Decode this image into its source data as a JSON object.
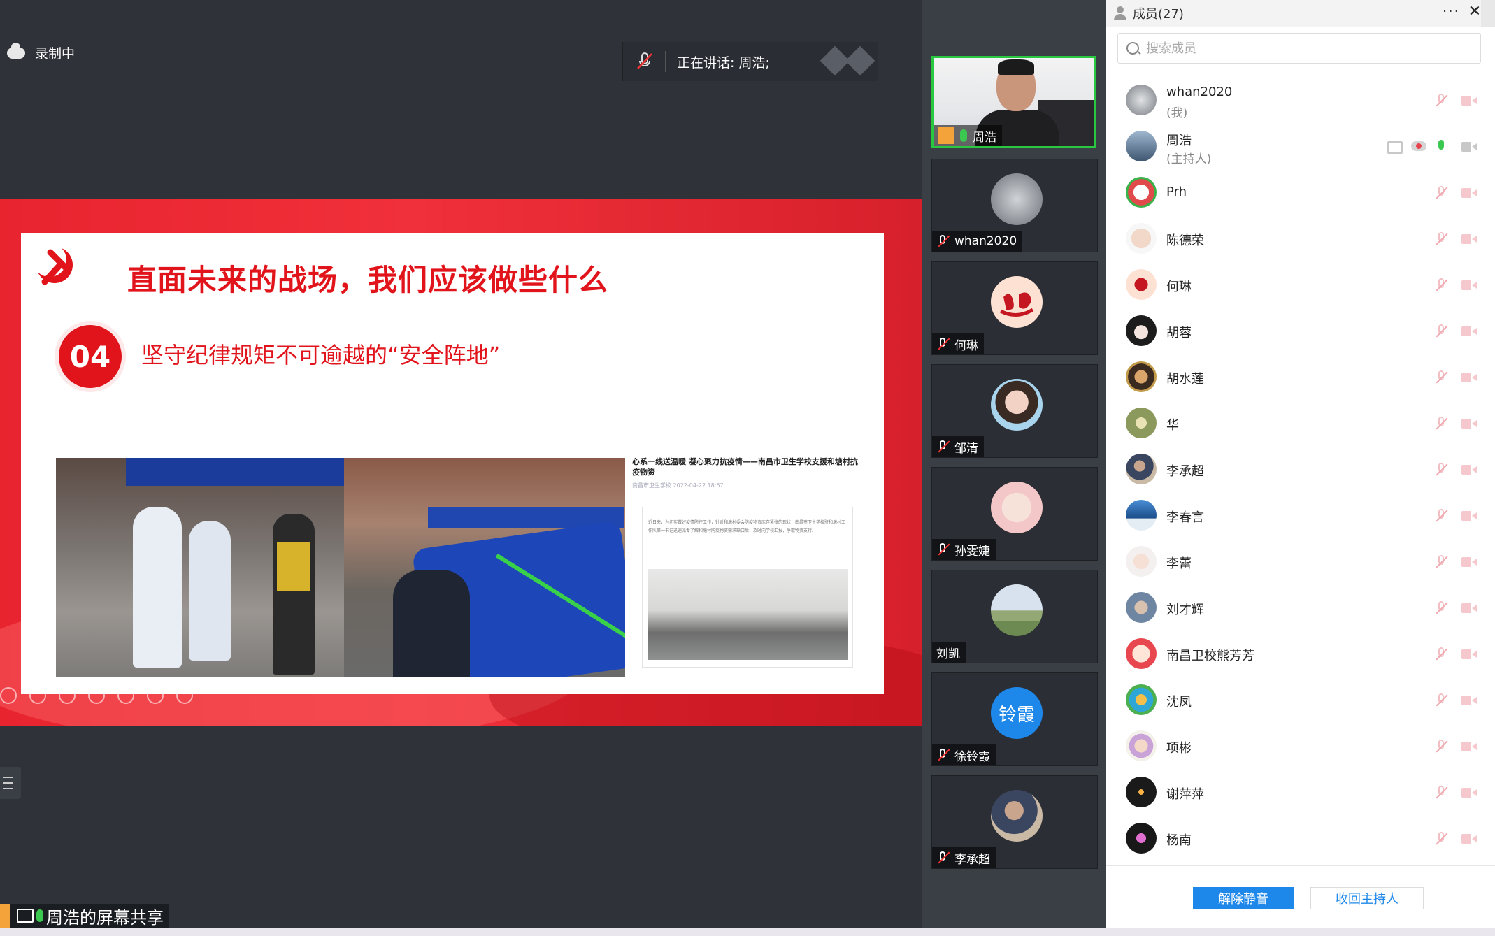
{
  "recording": {
    "label": "录制中"
  },
  "speaking": {
    "label": "正在讲话: 周浩;"
  },
  "slide": {
    "title": "直面未来的战场，我们应该做些什么",
    "number": "04",
    "subtitle": "坚守纪律规矩不可逾越的“安全阵地”",
    "article_headline": "心系一线送温暖 凝心聚力抗疫情——南昌市卫生学校支援和塘村抗疫物资",
    "article_meta": "南昌市卫生学校  2022-04-22 18:57",
    "article_text": "近日来，为切实做好疫情防控工作，针对和塘村委会防疫物资库存紧张的现状，南昌市卫生学校驻和塘村工作队第一书记迅速派专了解和塘村防疫物资需求缺口后，及时向学校汇报，争取物资支持。"
  },
  "share_label": "周浩的屏幕共享",
  "video_tiles": [
    {
      "name": "周浩",
      "active": true
    },
    {
      "name": "whan2020"
    },
    {
      "name": "何琳"
    },
    {
      "name": "邹清"
    },
    {
      "name": "孙雯婕"
    },
    {
      "name": "刘凯"
    },
    {
      "name": "徐铃霞",
      "avatar_text": "铃霞"
    },
    {
      "name": "李承超"
    }
  ],
  "panel": {
    "title": "成员(27)",
    "more": "···",
    "close": "✕",
    "search_placeholder": "搜索成员",
    "unmute_label": "解除静音",
    "reclaim_host_label": "收回主持人"
  },
  "members": [
    {
      "name": "whan2020",
      "role": "(我)"
    },
    {
      "name": "周浩",
      "role": "(主持人)"
    },
    {
      "name": "Prh"
    },
    {
      "name": "陈德荣"
    },
    {
      "name": "何琳"
    },
    {
      "name": "胡蓉"
    },
    {
      "name": "胡水莲"
    },
    {
      "name": "华"
    },
    {
      "name": "李承超"
    },
    {
      "name": "李春言"
    },
    {
      "name": "李蕾"
    },
    {
      "name": "刘才辉"
    },
    {
      "name": "南昌卫校熊芳芳"
    },
    {
      "name": "沈凤"
    },
    {
      "name": "项彬"
    },
    {
      "name": "谢萍萍"
    },
    {
      "name": "杨南"
    }
  ],
  "colors": {
    "accent": "#1e88ea",
    "slide_red": "#e1141c",
    "live_green": "#28c840"
  }
}
